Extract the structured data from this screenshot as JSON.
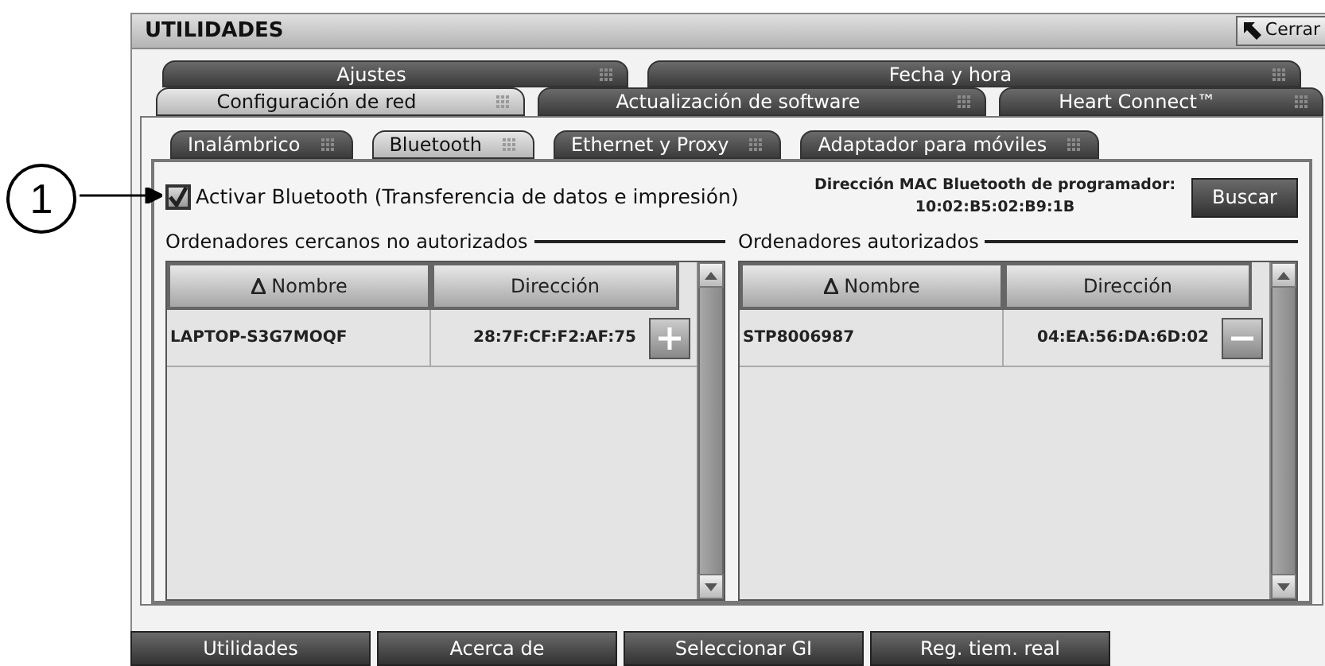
{
  "callout": "1",
  "window": {
    "title": "UTILIDADES",
    "close_button": "Cerrar"
  },
  "tab_rows": [
    [
      {
        "label": "Ajustes",
        "selected": false
      },
      {
        "label": "Fecha y hora",
        "selected": false
      }
    ],
    [
      {
        "label": "Configuración de red",
        "selected": true
      },
      {
        "label": "Actualización de software",
        "selected": false
      },
      {
        "label": "Heart Connect™",
        "selected": false
      }
    ]
  ],
  "sub_tabs": [
    {
      "label": "Inalámbrico",
      "selected": false
    },
    {
      "label": "Bluetooth",
      "selected": true
    },
    {
      "label": "Ethernet y Proxy",
      "selected": false
    },
    {
      "label": "Adaptador para móviles",
      "selected": false
    }
  ],
  "bluetooth": {
    "label": "Activar Bluetooth (Transferencia de datos e impresión)",
    "checked": true
  },
  "mac": {
    "label": "Dirección MAC Bluetooth de programador:",
    "value": "10:02:B5:02:B9:1B"
  },
  "search_button": "Buscar",
  "lists": [
    {
      "title": "Ordenadores cercanos no autorizados",
      "columns": [
        {
          "label": "Nombre",
          "sorted": true
        },
        {
          "label": "Dirección",
          "sorted": false
        }
      ],
      "rows": [
        {
          "name": "LAPTOP-S3G7MOQF",
          "address": "28:7F:CF:F2:AF:75",
          "kind": "add"
        }
      ]
    },
    {
      "title": "Ordenadores autorizados",
      "columns": [
        {
          "label": "Nombre",
          "sorted": true
        },
        {
          "label": "Dirección",
          "sorted": false
        }
      ],
      "rows": [
        {
          "name": "STP8006987",
          "address": "04:EA:56:DA:6D:02",
          "kind": "remove"
        }
      ]
    }
  ],
  "bottom_tabs": [
    {
      "label": "Utilidades"
    },
    {
      "label": "Acerca de"
    },
    {
      "label": "Seleccionar GI"
    },
    {
      "label": "Reg. tiem. real"
    }
  ]
}
